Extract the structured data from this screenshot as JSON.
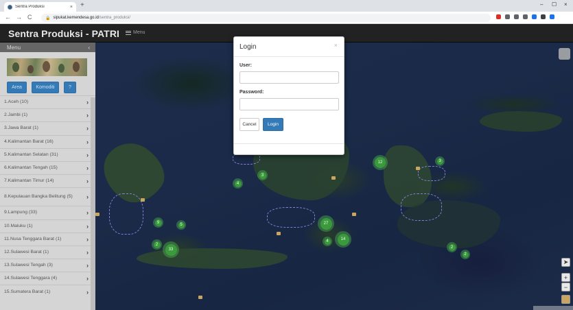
{
  "browser": {
    "tab_title": "Sentra Produksi",
    "tab_close": "×",
    "new_tab": "+",
    "back": "←",
    "forward": "→",
    "reload": "C",
    "url_host": "sipukat.kemendesa.go.id",
    "url_path": "/sentra_produksi/",
    "minimize": "–",
    "restore": "☐",
    "close": "×",
    "ext_colors": [
      "#d93025",
      "#5f6368",
      "#5f6368",
      "#5f6368",
      "#1a73e8",
      "#3c4043",
      "#1a73e8"
    ]
  },
  "navbar": {
    "brand": "Sentra Produksi - PATRI",
    "menu_label": "Menu"
  },
  "sidebar": {
    "header": "Menu",
    "collapse": "‹",
    "buttons": [
      "Area",
      "Komoditi",
      "?"
    ],
    "items": [
      "1.Aceh (10)",
      "2.Jambi (1)",
      "3.Jawa Barat (1)",
      "4.Kalimantan Barat (16)",
      "5.Kalimantan Selatan (31)",
      "6.Kalimantan Tengah (15)",
      "7.Kalimantan Timur (14)",
      "8.Kepulauan Bangka Belitung (5)",
      "9.Lampung (33)",
      "10.Maluku (1)",
      "11.Nusa Tenggara Barat (1)",
      "12.Sulawesi Barat (1)",
      "13.Sulawesi Tengah (3)",
      "14.Sulawesi Tenggara (4)",
      "15.Sumatera Barat (1)"
    ]
  },
  "map": {
    "clusters": [
      "12",
      "3",
      "4",
      "3",
      "9",
      "5",
      "27",
      "14",
      "4",
      "2",
      "33",
      "2",
      "2"
    ],
    "zoom_in": "+",
    "zoom_out": "−",
    "locate": "➤"
  },
  "login": {
    "title": "Login",
    "close": "×",
    "user_label": "User:",
    "user_value": "",
    "password_label": "Password:",
    "password_value": "",
    "cancel": "Cancel",
    "submit": "Login"
  }
}
